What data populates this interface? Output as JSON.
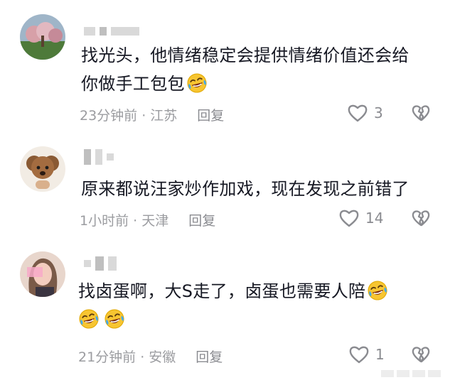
{
  "comments": [
    {
      "text_line1": "找光头，他情绪稳定会提供情绪价值还会给",
      "text_line2": "你做手工包包",
      "location_time": "23分钟前 · 江苏",
      "reply": "回复",
      "likes": "3"
    },
    {
      "text_line1": "原来都说汪家炒作加戏，现在发现之前错了",
      "location_time": "1小时前 · 天津",
      "reply": "回复",
      "likes": "14"
    },
    {
      "text_line1": "找卤蛋啊，大S走了，卤蛋也需要人陪",
      "location_time": "21分钟前 · 安徽",
      "reply": "回复",
      "likes": "1"
    }
  ],
  "icons": {
    "like": "heart-outline-icon",
    "dislike": "broken-heart-icon",
    "emoji": "tears-of-joy-emoji-icon"
  },
  "colors": {
    "text": "#161823",
    "meta": "#9b9ca0",
    "icon": "#8a8b90",
    "emoji_face": "#f7c531"
  }
}
